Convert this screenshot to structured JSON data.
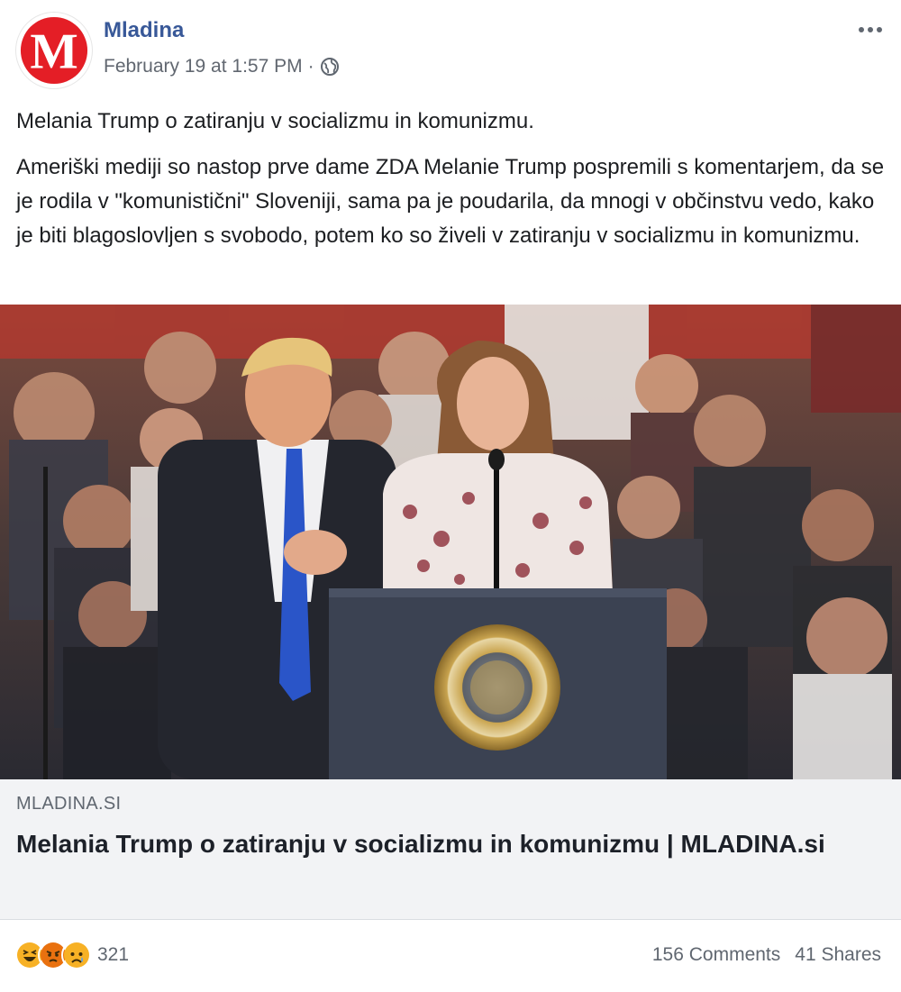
{
  "header": {
    "page_name": "Mladina",
    "timestamp": "February 19 at 1:57 PM",
    "separator": "·",
    "privacy_icon": "globe-icon",
    "avatar_letter": "M",
    "more_icon": "more-horizontal-icon"
  },
  "post": {
    "title": "Melania Trump o zatiranju v socializmu in komunizmu.",
    "body": "Ameriški mediji so nastop prve dame ZDA Melanie Trump pospremili s komentarjem, da se je rodila v \"komunistični\" Sloveniji, sama pa je poudarila, da mnogi v občinstvu vedo, kako je biti blagoslovljen s svobodo, potem ko so živeli v zatiranju v socializmu in komunizmu."
  },
  "link_preview": {
    "domain": "MLADINA.SI",
    "title": "Melania Trump o zatiranju v socializmu in komunizmu | MLADINA.si"
  },
  "footer": {
    "reaction_icons": [
      "haha-icon",
      "angry-icon",
      "sad-icon"
    ],
    "reaction_count": "321",
    "comments": "156 Comments",
    "shares": "41 Shares"
  },
  "colors": {
    "brand_red": "#e41e26",
    "link_blue": "#385898",
    "secondary_text": "#606770",
    "preview_bg": "#f2f3f5"
  }
}
